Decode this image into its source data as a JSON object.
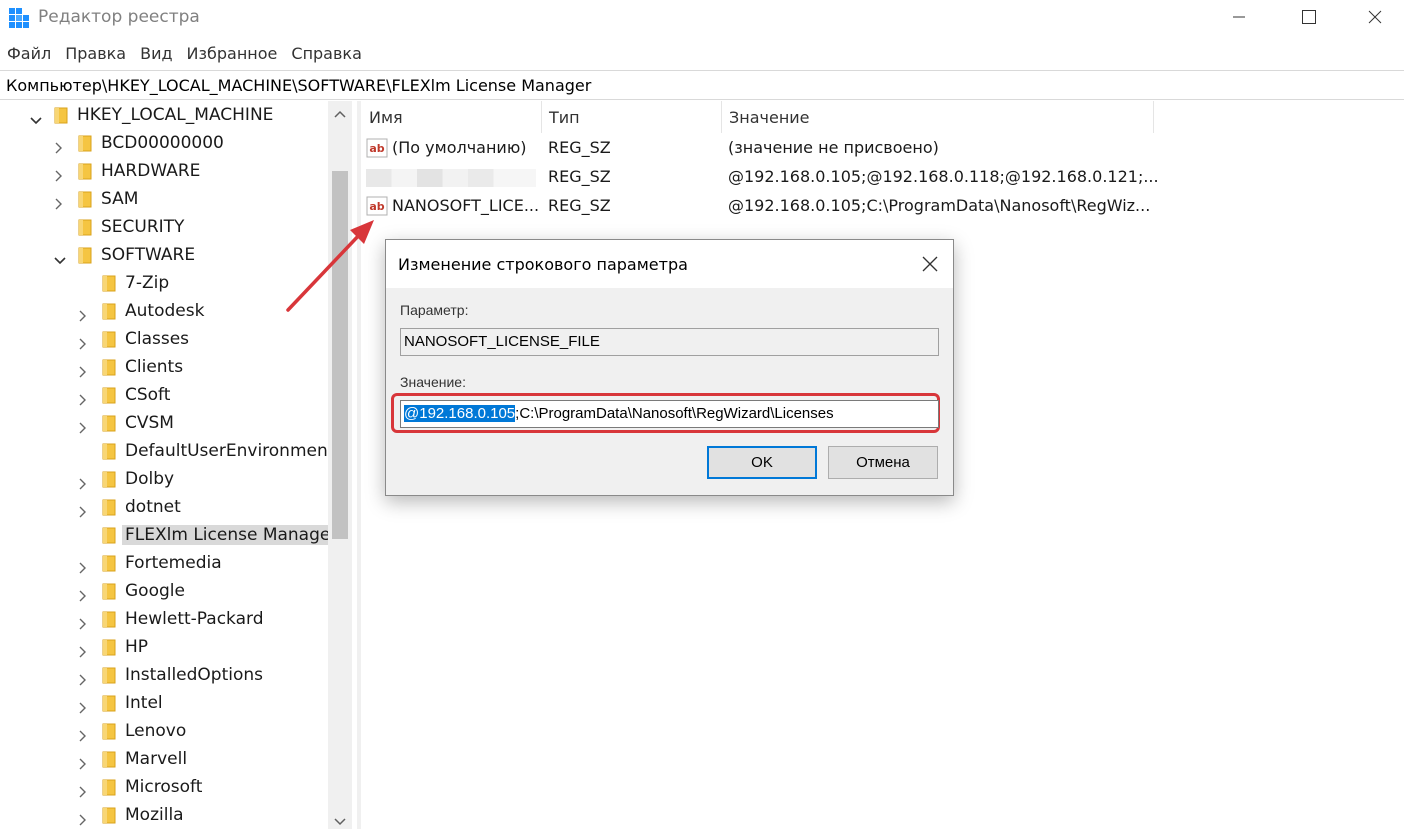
{
  "window": {
    "title": "Редактор реестра"
  },
  "menu": [
    "Файл",
    "Правка",
    "Вид",
    "Избранное",
    "Справка"
  ],
  "address": "Компьютер\\HKEY_LOCAL_MACHINE\\SOFTWARE\\FLEXlm License Manager",
  "tree": {
    "root": "HKEY_LOCAL_MACHINE",
    "level1": [
      "BCD00000000",
      "HARDWARE",
      "SAM",
      "SECURITY",
      "SOFTWARE"
    ],
    "software_children": [
      "7-Zip",
      "Autodesk",
      "Classes",
      "Clients",
      "CSoft",
      "CVSM",
      "DefaultUserEnvironment",
      "Dolby",
      "dotnet",
      "FLEXlm License Manager",
      "Fortemedia",
      "Google",
      "Hewlett-Packard",
      "HP",
      "InstalledOptions",
      "Intel",
      "Lenovo",
      "Marvell",
      "Microsoft",
      "Mozilla"
    ],
    "selected": "FLEXlm License Manager"
  },
  "list": {
    "columns": [
      "Имя",
      "Тип",
      "Значение"
    ],
    "rows": [
      {
        "name": "(По умолчанию)",
        "type": "REG_SZ",
        "value": "(значение не присвоено)"
      },
      {
        "name": "",
        "type": "REG_SZ",
        "value": "@192.168.0.105;@192.168.0.118;@192.168.0.121;..."
      },
      {
        "name": "NANOSOFT_LICE...",
        "type": "REG_SZ",
        "value": "@192.168.0.105;C:\\ProgramData\\Nanosoft\\RegWiz..."
      }
    ]
  },
  "dialog": {
    "title": "Изменение строкового параметра",
    "param_label": "Параметр:",
    "param_value": "NANOSOFT_LICENSE_FILE",
    "value_label": "Значение:",
    "value_selected": "@192.168.0.105",
    "value_rest": ";C:\\ProgramData\\Nanosoft\\RegWizard\\Licenses",
    "ok": "OK",
    "cancel": "Отмена"
  },
  "colors": {
    "selection": "#0078d7",
    "highlight_frame": "#d8363a",
    "arrow": "#d8363a",
    "folder": "#f5c542"
  }
}
